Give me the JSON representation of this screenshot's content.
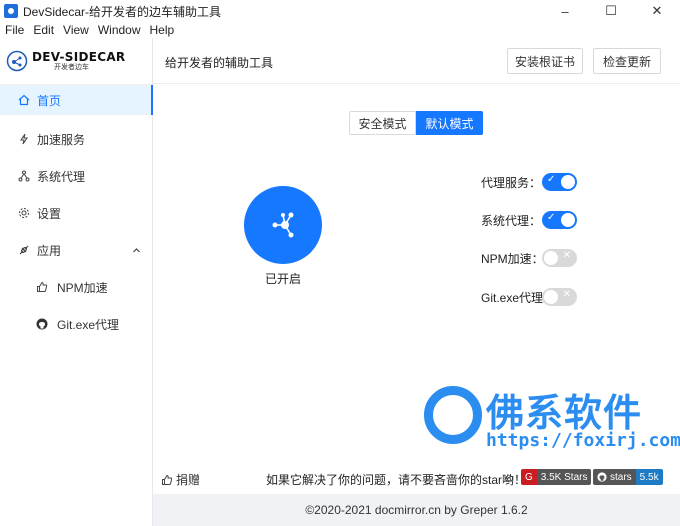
{
  "window": {
    "title": "DevSidecar-给开发者的边车辅助工具",
    "controls": {
      "minimize": "–",
      "maximize": "☐",
      "close": "✕"
    }
  },
  "menu": [
    "File",
    "Edit",
    "View",
    "Window",
    "Help"
  ],
  "logo": {
    "main": "DEV-SIDECAR",
    "sub": "开发者边车"
  },
  "sidebar": {
    "items": [
      {
        "label": "首页",
        "icon": "home-icon",
        "active": true
      },
      {
        "label": "加速服务",
        "icon": "thunder-icon"
      },
      {
        "label": "系统代理",
        "icon": "network-icon"
      },
      {
        "label": "设置",
        "icon": "gear-icon"
      },
      {
        "label": "应用",
        "icon": "api-icon",
        "expanded": true
      },
      {
        "label": "NPM加速",
        "icon": "like-icon",
        "sub": true
      },
      {
        "label": "Git.exe代理",
        "icon": "github-icon",
        "sub": true
      }
    ]
  },
  "header": {
    "title": "给开发者的辅助工具",
    "install_cert": "安装根证书",
    "check_update": "检查更新"
  },
  "mode": {
    "safe": "安全模式",
    "default": "默认模式",
    "selected": "默认模式"
  },
  "main": {
    "status": "已开启"
  },
  "settings": [
    {
      "label": "代理服务：",
      "on": true
    },
    {
      "label": "系统代理：",
      "on": true
    },
    {
      "label": "NPM加速：",
      "on": false
    },
    {
      "label": "Git.exe代理",
      "on": false
    }
  ],
  "toggle_marks": {
    "on": "✓",
    "off": "✕"
  },
  "footer": {
    "donate": "捐赠",
    "notice": "如果它解决了你的问题，请不要吝啬你的star哟！",
    "smile": "☺",
    "gitee_badge": {
      "value": "3.5K Stars",
      "color": "#c71d23"
    },
    "github_badge": {
      "label": "stars",
      "value": "5.5k",
      "color": "#1f7bc4"
    }
  },
  "copyright": "©2020-2021 docmirror.cn by Greper 1.6.2",
  "watermark": {
    "text": "佛系软件",
    "url": "https://foxirj.com"
  }
}
